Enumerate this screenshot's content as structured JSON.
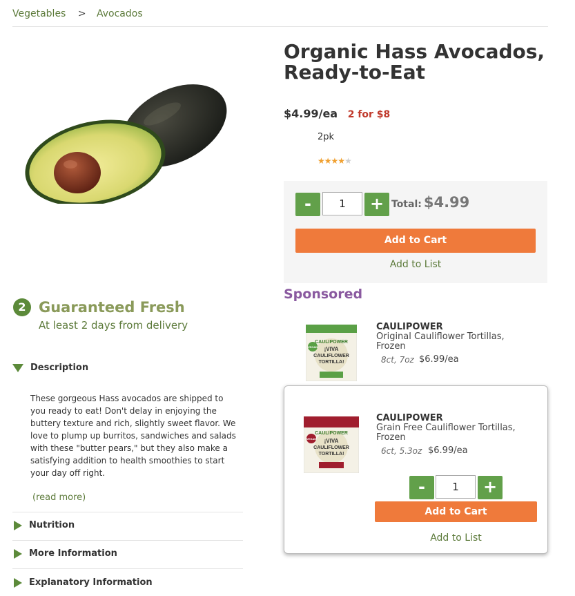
{
  "breadcrumb": {
    "items": [
      "Vegetables",
      "Avocados"
    ],
    "separator": ">"
  },
  "product": {
    "title": "Organic Hass Avocados, Ready-to-Eat",
    "price": "$4.99/ea",
    "deal": "2 for $8",
    "size": "2pk",
    "rating": 4,
    "rating_max": 5
  },
  "cart": {
    "minus": "-",
    "plus": "+",
    "quantity": "1",
    "total_label": "Total:",
    "total_value": "$4.99",
    "add_to_cart": "Add to Cart",
    "add_to_list": "Add to List"
  },
  "sponsored": {
    "label": "Sponsored",
    "items": [
      {
        "brand": "CAULIPOWER",
        "name": "Original Cauliflower Tortillas, Frozen",
        "size": "8ct, 7oz",
        "price": "$6.99/ea"
      },
      {
        "brand": "CAULIPOWER",
        "name": "Grain Free Cauliflower Tortillas, Frozen",
        "size": "6ct, 5.3oz",
        "price": "$6.99/ea",
        "quantity": "1",
        "add_to_cart": "Add to Cart",
        "add_to_list": "Add to List"
      }
    ],
    "package_text": {
      "brand": "CAULIPOWER",
      "line1": "¡VIVA",
      "line2": "CAULIFLOWER",
      "line3": "TORTILLA!",
      "badge": "VEGAN"
    }
  },
  "fresh": {
    "number": "2",
    "title": "Guaranteed Fresh",
    "subtitle": "At least 2 days from delivery"
  },
  "accordion": {
    "description_label": "Description",
    "description_text": "These gorgeous Hass avocados are shipped to you ready to eat! Don't delay in enjoying the buttery texture and rich, slightly sweet flavor. We love to plump up burritos, sandwiches and salads with these \"butter pears,\" but they also make a satisfying addition to health smoothies to start your day off right.",
    "read_more": "(read more)",
    "nutrition_label": "Nutrition",
    "more_info_label": "More Information",
    "explanatory_label": "Explanatory Information"
  },
  "colors": {
    "accent_green": "#62a04a",
    "cta_orange": "#ef7a3b",
    "deal_red": "#c0392b",
    "sponsored_purple": "#8a5aa0"
  }
}
